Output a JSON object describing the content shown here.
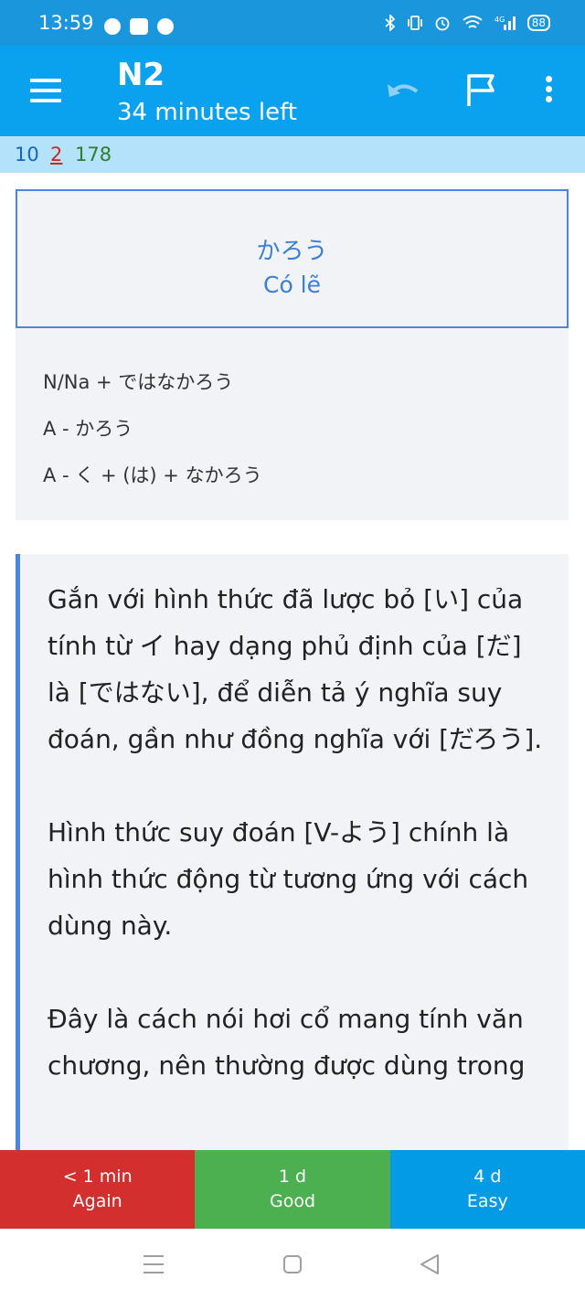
{
  "status_bar": {
    "time": "13:59",
    "battery": "88",
    "network": "4G"
  },
  "app_bar": {
    "title": "N2",
    "subtitle": "34 minutes left"
  },
  "counts": {
    "new": "10",
    "learning": "2",
    "review": "178"
  },
  "card": {
    "front_word": "かろう",
    "front_meaning": "Có lẽ",
    "patterns": [
      "N/Na + ではなかろう",
      "A - かろう",
      "A - く + (は) + なかろう"
    ],
    "explanation": [
      "Gắn với hình thức đã lược bỏ [い] của tính từ イ hay dạng phủ định của [だ] là [ではない], để diễn tả ý nghĩa suy đoán, gần như đồng nghĩa với [だろう].",
      "Hình thức suy đoán [V-よう] chính là hình thức động từ tương ứng với cách dùng này.",
      "Đây là cách nói hơi cổ mang tính văn chương, nên thường được dùng trong"
    ]
  },
  "answer_buttons": {
    "again": {
      "interval": "< 1 min",
      "label": "Again"
    },
    "good": {
      "interval": "1 d",
      "label": "Good"
    },
    "easy": {
      "interval": "4 d",
      "label": "Easy"
    }
  },
  "colors": {
    "status_bar": "#1a97dc",
    "app_bar": "#0aa2ee",
    "count_bar": "#b4e2fa",
    "accent_border": "#4a86e0",
    "again": "#d32f2f",
    "good": "#4caf50",
    "easy": "#039be5"
  }
}
